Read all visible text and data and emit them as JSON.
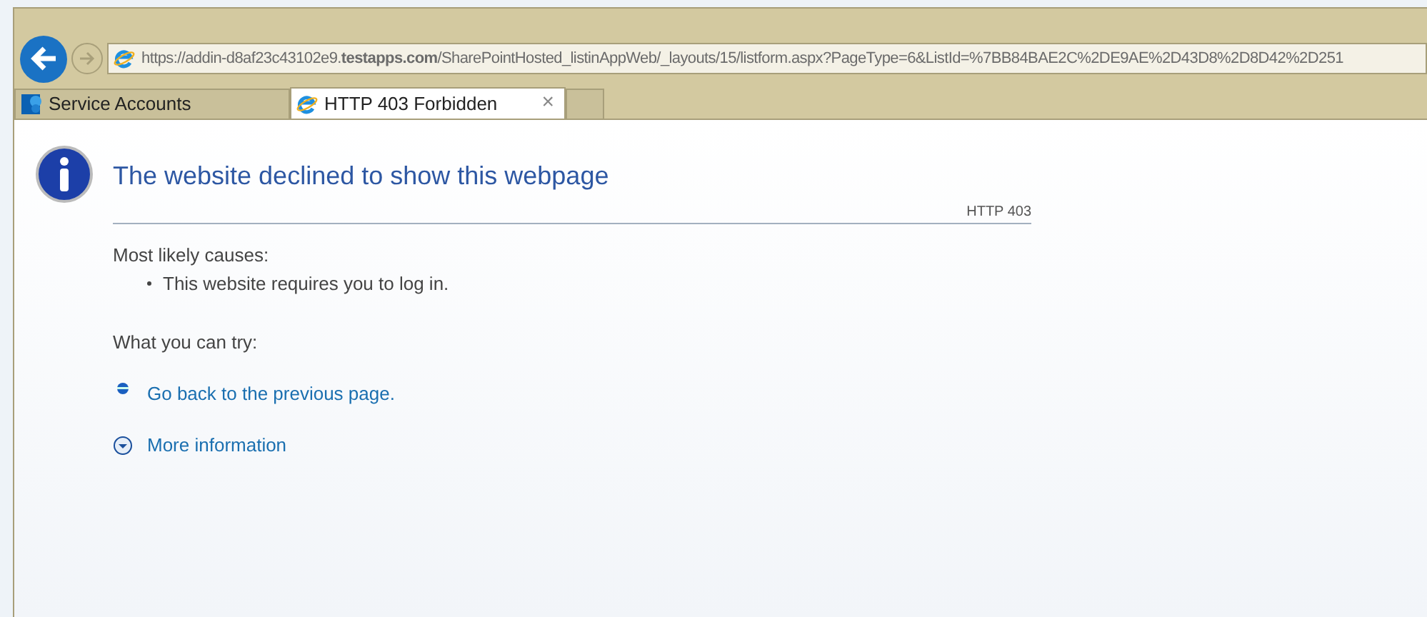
{
  "address_bar": {
    "url": "https://addin-d8af23c43102e9.**testapps.com**/SharePointHosted_listinAppWeb/_layouts/15/listform.aspx?PageType=6&ListId=%7BB84BAE2C%2DE9AE%2D43D8%2D8D42%2D251"
  },
  "tabs": [
    {
      "label": "Service Accounts",
      "selected": false,
      "kind": "sharepoint"
    },
    {
      "label": "HTTP 403 Forbidden",
      "selected": true,
      "kind": "ie",
      "close": "×"
    }
  ],
  "page": {
    "title": "The website declined to show this webpage",
    "code": "HTTP 403",
    "causes_heading": "Most likely causes:",
    "causes": [
      "This website requires you to log in."
    ],
    "try_heading": "What you can try:",
    "actions": [
      {
        "label": "Go back to the previous page.",
        "kind": "bullet"
      },
      {
        "label": "More information",
        "kind": "expand"
      }
    ]
  }
}
